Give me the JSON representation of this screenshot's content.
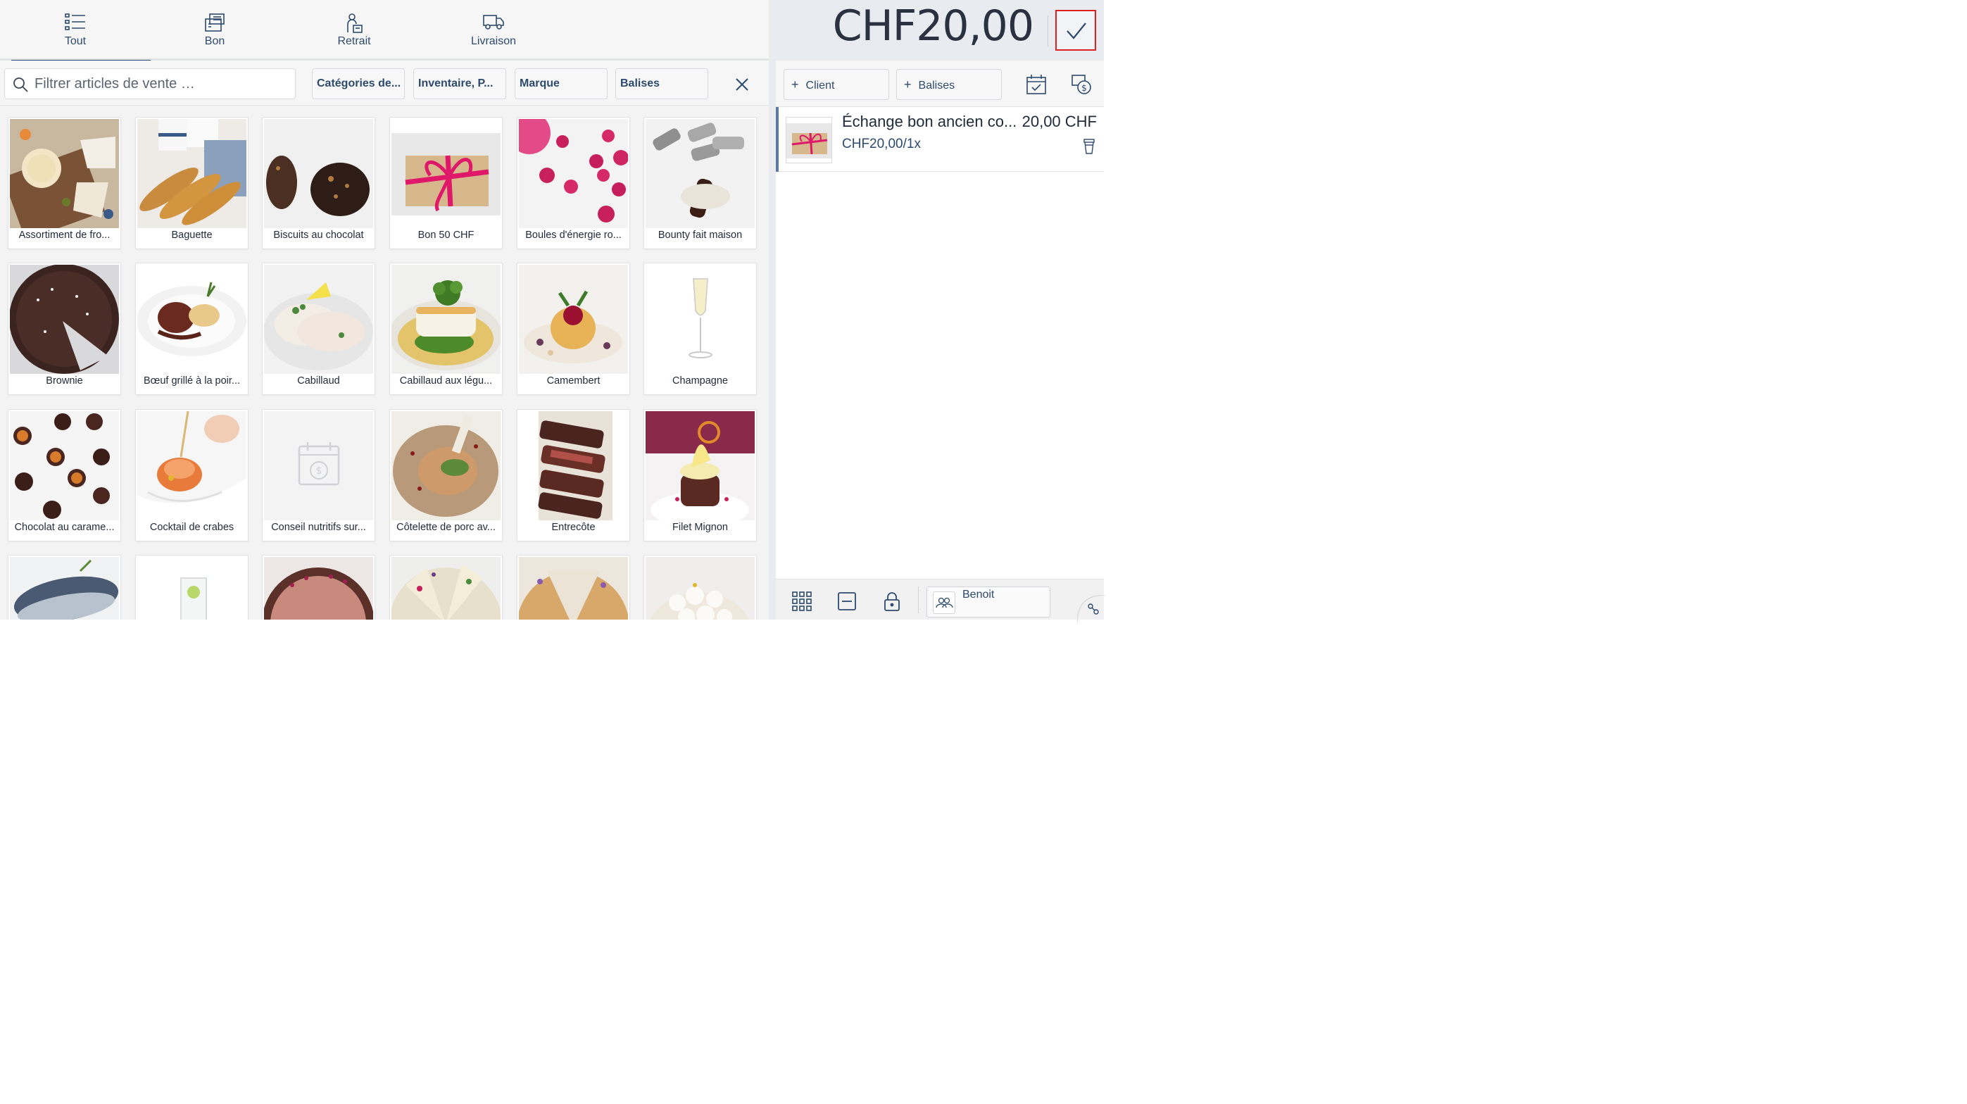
{
  "tabs": [
    {
      "label": "Tout",
      "icon": "list-icon",
      "active": true
    },
    {
      "label": "Bon",
      "icon": "voucher-icon",
      "active": false
    },
    {
      "label": "Retrait",
      "icon": "pickup-icon",
      "active": false
    },
    {
      "label": "Livraison",
      "icon": "delivery-truck-icon",
      "active": false
    }
  ],
  "filters": {
    "search_placeholder": "Filtrer articles de vente …",
    "chips": [
      "Catégories de...",
      "Inventaire, P...",
      "Marque",
      "Balises"
    ]
  },
  "products": [
    {
      "name": "Assortiment de fro..."
    },
    {
      "name": "Baguette"
    },
    {
      "name": "Biscuits au chocolat"
    },
    {
      "name": "Bon 50 CHF"
    },
    {
      "name": "Boules d'énergie ro..."
    },
    {
      "name": "Bounty fait maison"
    },
    {
      "name": "Brownie"
    },
    {
      "name": "Bœuf grillé à la poir..."
    },
    {
      "name": "Cabillaud"
    },
    {
      "name": "Cabillaud aux légu..."
    },
    {
      "name": "Camembert"
    },
    {
      "name": "Champagne"
    },
    {
      "name": "Chocolat au carame..."
    },
    {
      "name": "Cocktail de crabes"
    },
    {
      "name": "Conseil nutritifs sur..."
    },
    {
      "name": "Côtelette de porc av..."
    },
    {
      "name": "Entrecôte"
    },
    {
      "name": "Filet Mignon"
    },
    {
      "name": ""
    },
    {
      "name": ""
    },
    {
      "name": ""
    },
    {
      "name": ""
    },
    {
      "name": ""
    },
    {
      "name": ""
    }
  ],
  "cart": {
    "total": "CHF20,00",
    "client_label": "Client",
    "tags_label": "Balises",
    "items": [
      {
        "title": "Échange bon ancien co...",
        "price": "20,00 CHF",
        "detail": "CHF20,00/1x"
      }
    ]
  },
  "footer": {
    "user": "Benoit"
  },
  "colors": {
    "accent": "#2d4a6e",
    "confirm_border": "#e02020",
    "header_bg": "#e8ebf0"
  }
}
